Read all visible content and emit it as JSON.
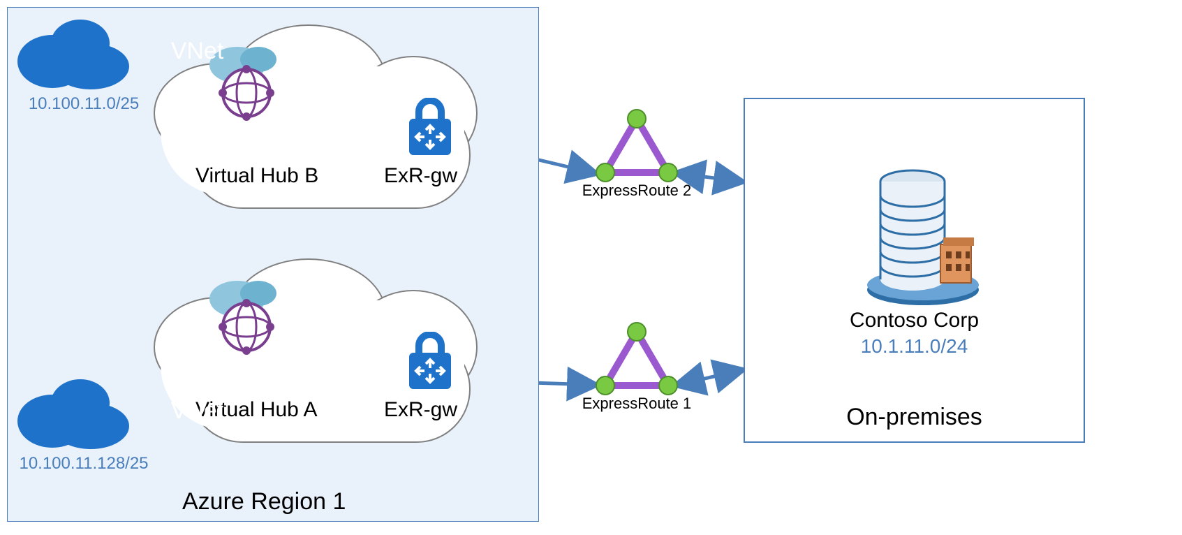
{
  "region": {
    "label": "Azure Region 1"
  },
  "hubs": {
    "a": {
      "label": "Virtual Hub A",
      "gw_label": "ExR-gw"
    },
    "b": {
      "label": "Virtual Hub B",
      "gw_label": "ExR-gw"
    }
  },
  "vnets": {
    "top": {
      "label": "VNet",
      "cidr": "10.100.11.0/25"
    },
    "bottom": {
      "label": "VNet",
      "cidr": "10.100.11.128/25"
    }
  },
  "expressroutes": {
    "one": {
      "label": "ExpressRoute 1"
    },
    "two": {
      "label": "ExpressRoute 2"
    }
  },
  "onprem": {
    "box_label": "On-premises",
    "corp_label": "Contoso Corp",
    "cidr": "10.1.11.0/24"
  }
}
